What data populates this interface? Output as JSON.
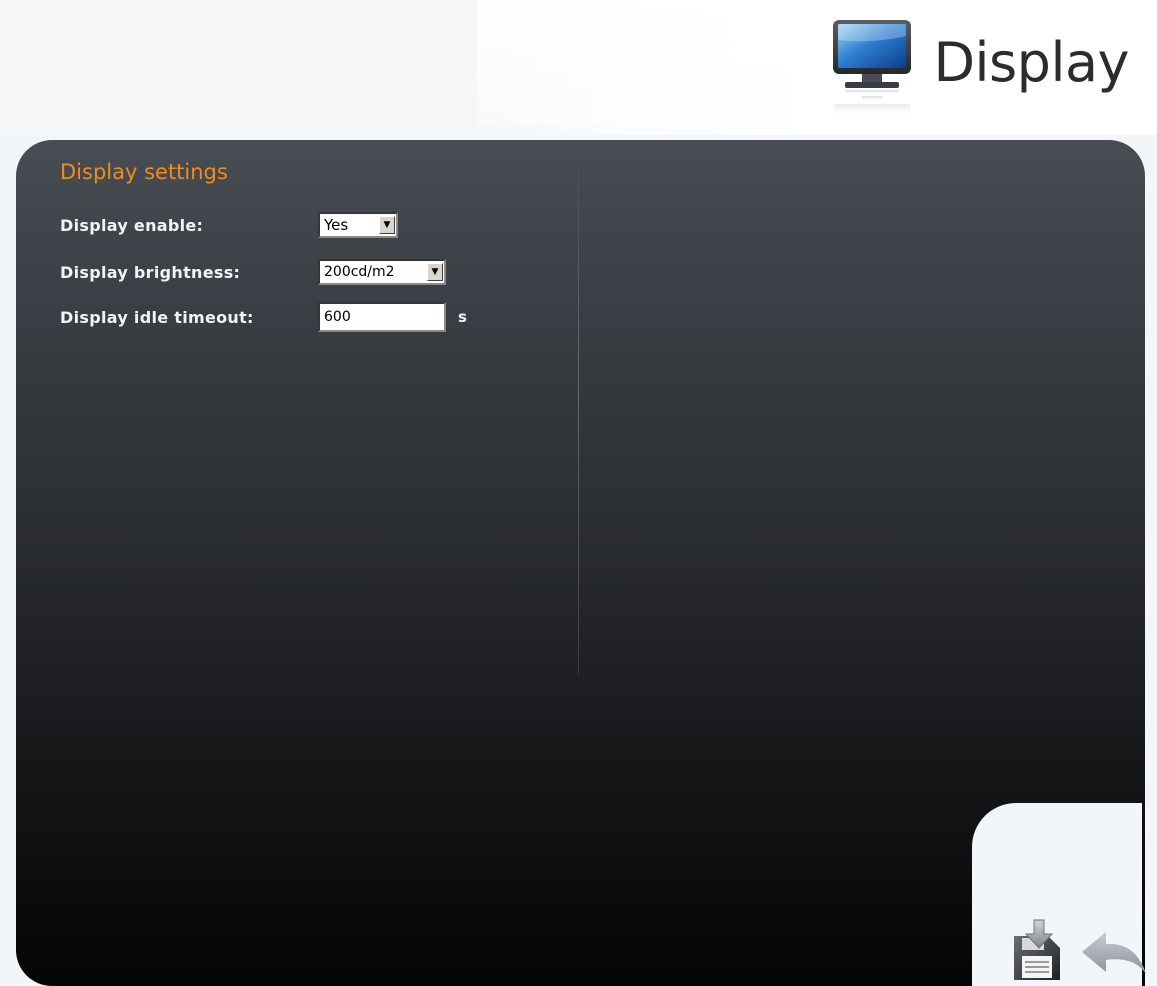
{
  "header": {
    "title": "Display",
    "icon": "monitor-icon"
  },
  "settings": {
    "section_title": "Display settings",
    "enable": {
      "label": "Display enable:",
      "value": "Yes"
    },
    "brightness": {
      "label": "Display brightness:",
      "value": "200cd/m2"
    },
    "idle_timeout": {
      "label": "Display idle timeout:",
      "value": "600",
      "unit": "s"
    }
  },
  "actions": {
    "save_icon": "save-icon",
    "back_icon": "back-arrow-icon"
  },
  "colors": {
    "accent": "#f08a24",
    "panel_top": "#484d53",
    "panel_bottom": "#040404"
  }
}
